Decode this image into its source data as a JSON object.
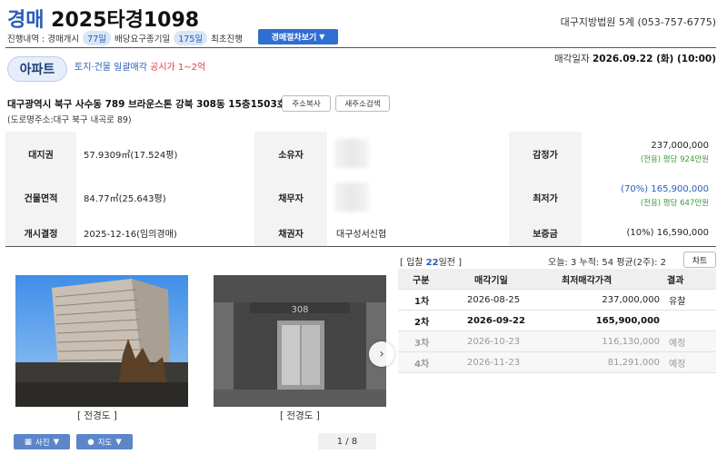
{
  "header": {
    "case_type": "경매",
    "case_number": "2025타경1098",
    "court": "대구지방법원 5계 (053-757-6775)",
    "progress_label": "진행내역 : 경매개시",
    "progress_days": "77일",
    "dividend_label": "배당요구종기일",
    "dividend_days": "175일",
    "first_progress": "최초진행",
    "procedure_button": "경매절차보기",
    "sale_date_label": "매각일자",
    "sale_date_value": "2026.09.22 (화) (10:00)"
  },
  "property": {
    "badge": "아파트",
    "sale_type": "토지·건물 일괄매각",
    "sale_note": "공시가 1~2억",
    "address": "대구광역시 북구 사수동 789 브라운스톤 강북 308동 15층1503호",
    "road_address": "(도로명주소:대구 북구 내곡로 89)",
    "copy_button": "주소복사",
    "new_address_button": "새주소검색"
  },
  "info": {
    "land_label": "대지권",
    "land_value": "57.9309㎡(17.524평)",
    "owner_label": "소유자",
    "appraisal_label": "감정가",
    "appraisal_value": "237,000,000",
    "appraisal_sub": "(전용) 평당 924만원",
    "building_label": "건물면적",
    "building_value": "84.77㎡(25.643평)",
    "debtor_label": "채무자",
    "min_label": "최저가",
    "min_value": "(70%) 165,900,000",
    "min_sub": "(전용) 평당 647만원",
    "start_label": "개시결정",
    "start_value": "2025-12-16(임의경매)",
    "creditor_label": "채권자",
    "creditor_value": "대구성서신협",
    "deposit_label": "보증금",
    "deposit_value": "(10%) 16,590,000"
  },
  "photos": {
    "caption1": "[ 전경도 ]",
    "caption2": "[ 전경도 ]",
    "photo_button": "사진",
    "map_button": "지도",
    "pager": "1 / 8",
    "building_sign": "308"
  },
  "schedule": {
    "bid_prefix": "[ 입찰",
    "bid_days": "22",
    "bid_suffix": "일전 ]",
    "visit_text": "오늘: 3 누적: 54 평균(2주): 2",
    "chart_button": "차트",
    "headers": [
      "구분",
      "매각기일",
      "최저매각가격",
      "결과"
    ],
    "rows": [
      {
        "round": "1차",
        "date": "2026-08-25",
        "price": "237,000,000",
        "result": "유찰"
      },
      {
        "round": "2차",
        "date": "2026-09-22",
        "price": "165,900,000",
        "result": ""
      },
      {
        "round": "3차",
        "date": "2026-10-23",
        "price": "116,130,000",
        "result": "예정"
      },
      {
        "round": "4차",
        "date": "2026-11-23",
        "price": "81,291,000",
        "result": "예정"
      }
    ]
  },
  "colors": {
    "accent": "#2a5cb8",
    "button": "#2f6fd1",
    "highlight": "#e03c3c",
    "green": "#3c9a3c"
  }
}
